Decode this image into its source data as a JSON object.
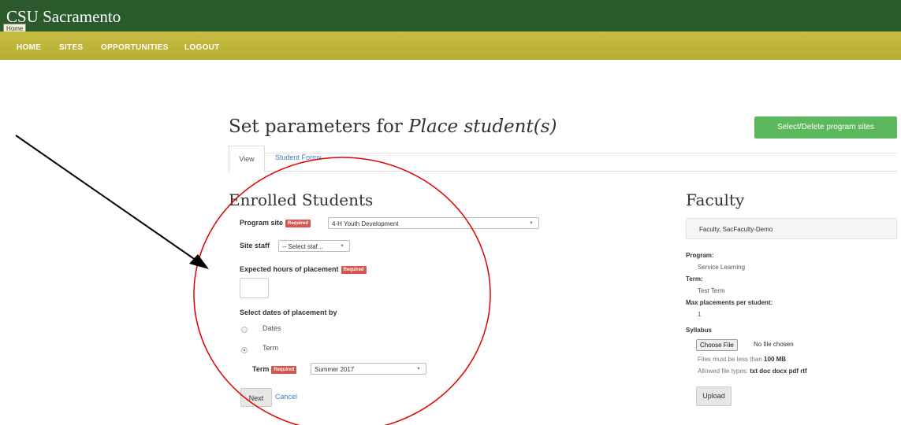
{
  "header": {
    "brand": "CSU Sacramento",
    "home_tooltip": "Home"
  },
  "nav": {
    "items": [
      "HOME",
      "SITES",
      "OPPORTUNITIES",
      "LOGOUT"
    ]
  },
  "page": {
    "title_prefix": "Set parameters for ",
    "title_italic": "Place student(s)",
    "select_delete_button": "Select/Delete program sites"
  },
  "tabs": [
    "View",
    "Student Forms"
  ],
  "enrolled": {
    "heading": "Enrolled Students",
    "program_site_label": "Program site",
    "required": "Required",
    "program_site_value": "4-H Youth Development",
    "site_staff_label": "Site staff",
    "site_staff_value": "-- Select staf...",
    "hours_label": "Expected hours of placement",
    "dates_by_label": "Select dates of placement by",
    "radio_dates": "Dates",
    "radio_term": "Term",
    "term_label": "Term",
    "term_value": "Summer 2017",
    "next": "Next",
    "cancel": "Cancel"
  },
  "faculty": {
    "heading": "Faculty",
    "name": "Faculty, SacFaculty-Demo",
    "program_label": "Program:",
    "program_value": "Service Learning",
    "term_label": "Term:",
    "term_value": "Test Term",
    "max_label": "Max placements per student:",
    "max_value": "1",
    "syllabus_label": "Syllabus",
    "choose_file": "Choose File",
    "no_file": "No file chosen",
    "size_note_prefix": "Files must be less than ",
    "size_note_value": "100 MB",
    "size_note_suffix": ".",
    "types_prefix": "Allowed file types: ",
    "types_value": "txt doc docx pdf rtf",
    "upload": "Upload"
  },
  "annotation": {
    "color": "#e00000",
    "arrow_color": "#000000"
  },
  "colors": {
    "topbar": "#2b5a2c",
    "navbar": "#bfb53a",
    "green_button": "#5cb85c",
    "required_badge": "#d9534f",
    "link": "#3a7fc4"
  }
}
